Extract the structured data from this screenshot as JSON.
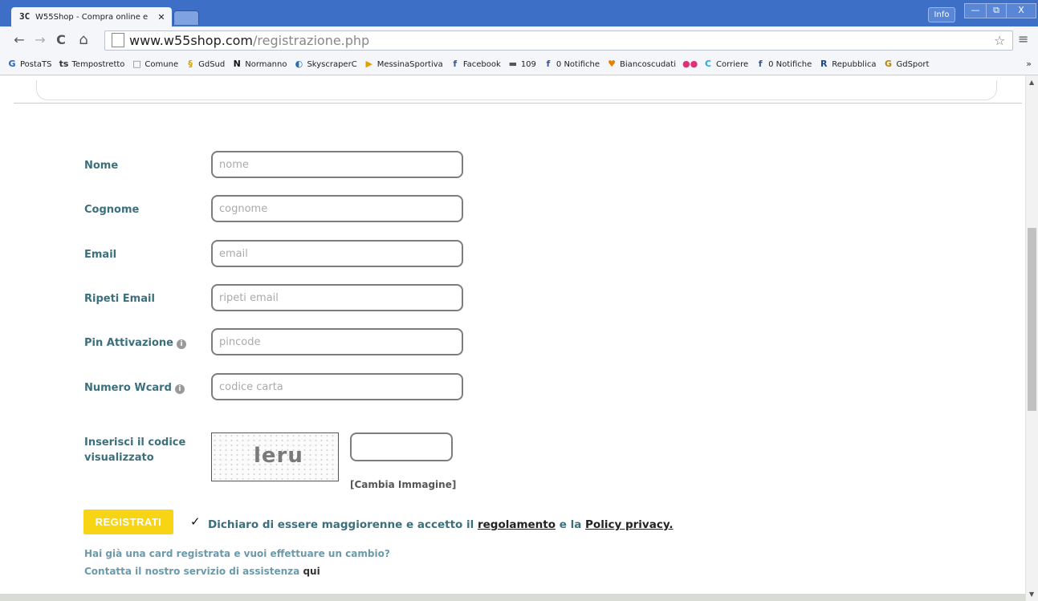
{
  "browser": {
    "tab_title": "W55Shop - Compra online e",
    "tab_favicon": "3C",
    "tab_close": "✕",
    "info_label": "Info",
    "minimize": "—",
    "maximize": "⧉",
    "close": "X",
    "url_host": "www.w55shop.com",
    "url_path": "/registrazione.php",
    "back": "←",
    "forward": "→",
    "reload": "C",
    "home": "⌂",
    "star": "☆",
    "menu": "≡"
  },
  "bookmarks": [
    {
      "label": "PostaTS",
      "icon": "G",
      "color": "#2a62c9"
    },
    {
      "label": "Tempostretto",
      "icon": "ts",
      "color": "#333"
    },
    {
      "label": "Comune",
      "icon": "□",
      "color": "#777"
    },
    {
      "label": "GdSud",
      "icon": "§",
      "color": "#d3a400"
    },
    {
      "label": "Normanno",
      "icon": "N",
      "color": "#111"
    },
    {
      "label": "SkyscraperC",
      "icon": "◐",
      "color": "#2b6fb2"
    },
    {
      "label": "MessinaSportiva",
      "icon": "▶",
      "color": "#e0a000"
    },
    {
      "label": "Facebook",
      "icon": "f",
      "color": "#3b5998"
    },
    {
      "label": "109",
      "icon": "▬",
      "color": "#555"
    },
    {
      "label": "0 Notifiche",
      "icon": "f",
      "color": "#3b5998"
    },
    {
      "label": "Biancoscudati",
      "icon": "♥",
      "color": "#e67e00"
    },
    {
      "label": "",
      "icon": "●●",
      "color": "#e0307a"
    },
    {
      "label": "Corriere",
      "icon": "C",
      "color": "#2aa6e0"
    },
    {
      "label": "0 Notifiche",
      "icon": "f",
      "color": "#3b5998"
    },
    {
      "label": "Repubblica",
      "icon": "R",
      "color": "#1a4a8a"
    },
    {
      "label": "GdSport",
      "icon": "G",
      "color": "#c08000"
    }
  ],
  "bookmarks_more": "»",
  "form": {
    "nome": {
      "label": "Nome",
      "placeholder": "nome"
    },
    "cognome": {
      "label": "Cognome",
      "placeholder": "cognome"
    },
    "email": {
      "label": "Email",
      "placeholder": "email"
    },
    "ripeti_email": {
      "label": "Ripeti Email",
      "placeholder": "ripeti email"
    },
    "pin": {
      "label": "Pin Attivazione",
      "placeholder": "pincode",
      "info": "i"
    },
    "wcard": {
      "label": "Numero Wcard",
      "placeholder": "codice carta",
      "info": "i"
    },
    "captcha": {
      "label_line1": "Inserisci il codice",
      "label_line2": "visualizzato",
      "image_text": "leru",
      "change": "[Cambia Immagine]"
    }
  },
  "register_button": "REGISTRATI",
  "agree": {
    "checkmark": "✓",
    "text_before": "Dichiaro di essere maggiorenne e accetto il ",
    "link1": "regolamento",
    "text_middle": " e la ",
    "link2": "Policy privacy."
  },
  "help": {
    "line1": "Hai già una card registrata e vuoi effettuare un cambio?",
    "line2": "Contatta il nostro servizio di assistenza ",
    "line2_link": "qui"
  },
  "scrollbar": {
    "up": "▲",
    "down": "▼"
  }
}
